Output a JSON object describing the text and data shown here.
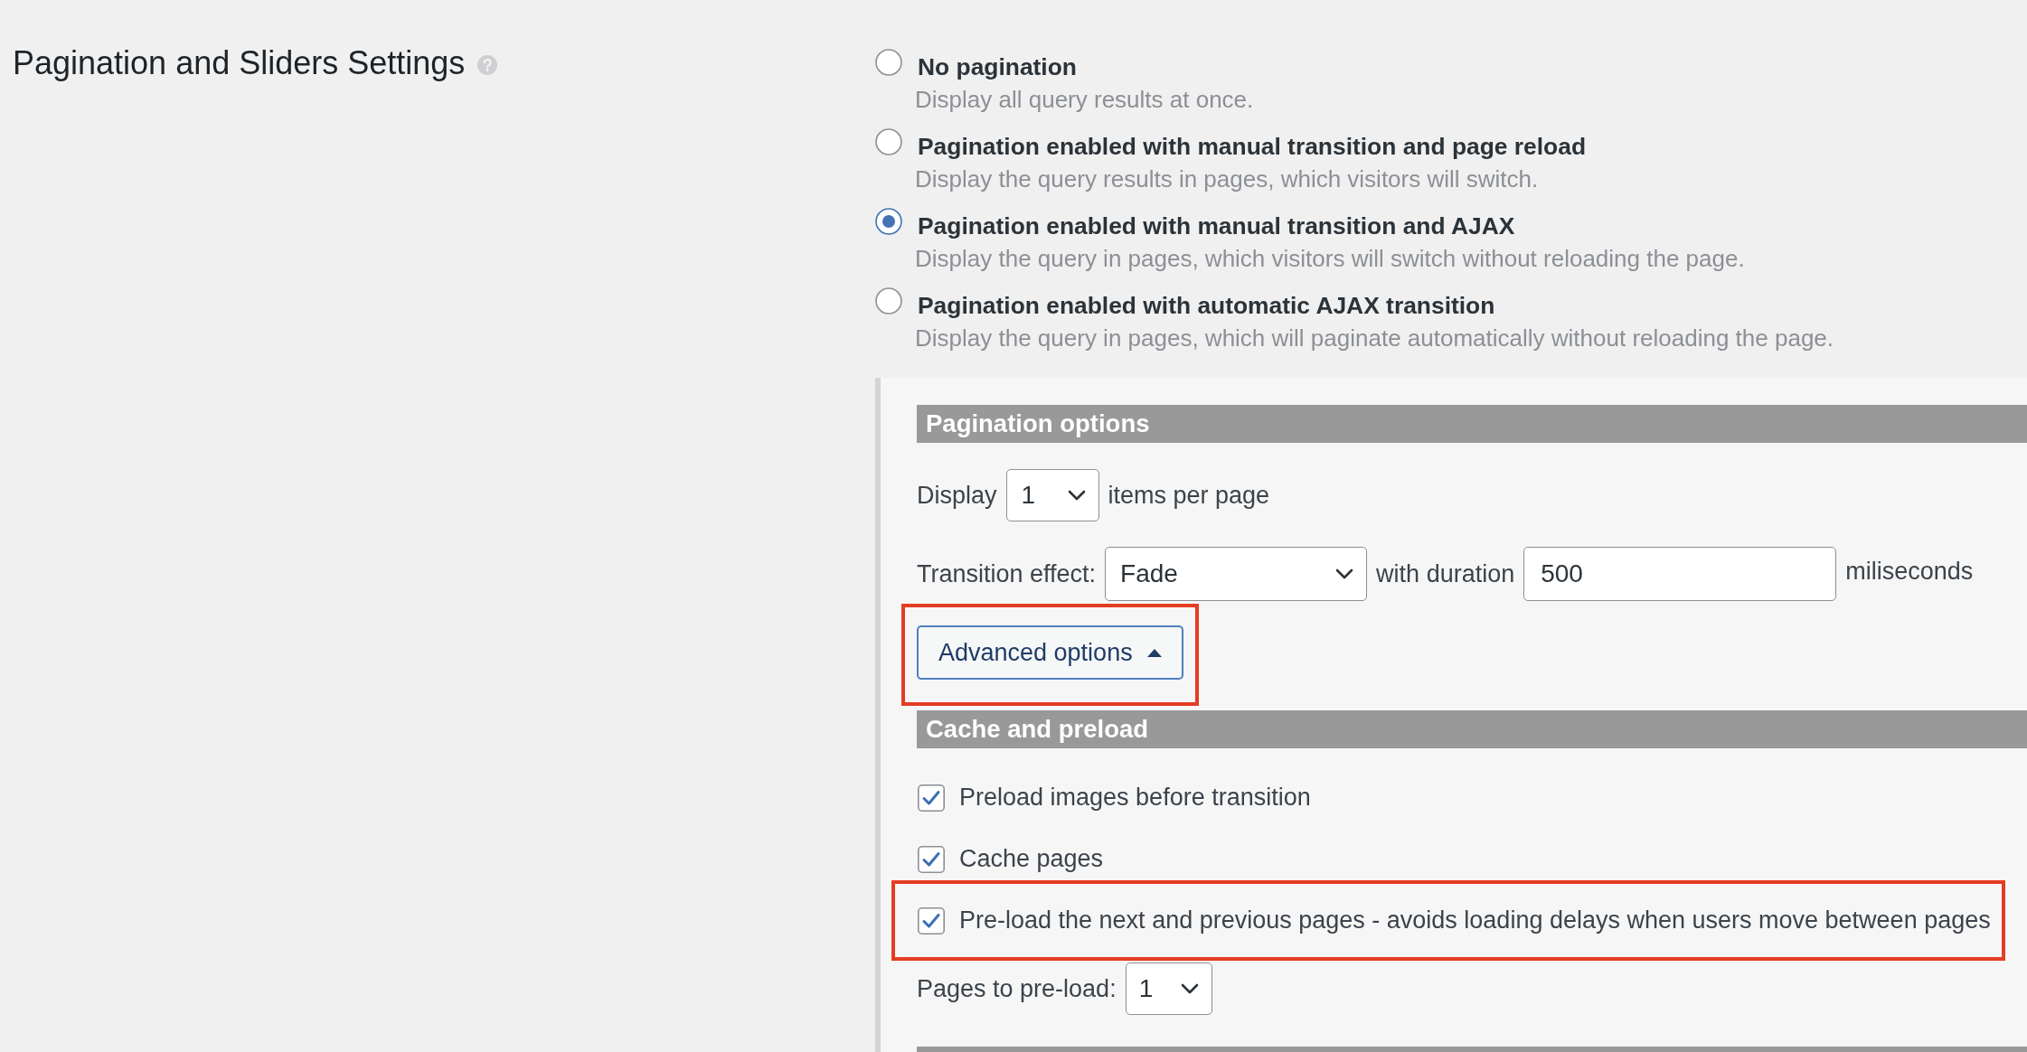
{
  "settings_title": "Pagination and Sliders Settings",
  "pagination_modes": [
    {
      "label": "No pagination",
      "description": "Display all query results at once.",
      "selected": false
    },
    {
      "label": "Pagination enabled with manual transition and page reload",
      "description": "Display the query results in pages, which visitors will switch.",
      "selected": false
    },
    {
      "label": "Pagination enabled with manual transition and AJAX",
      "description": "Display the query in pages, which visitors will switch without reloading the page.",
      "selected": true
    },
    {
      "label": "Pagination enabled with automatic AJAX transition",
      "description": "Display the query in pages, which will paginate automatically without reloading the page.",
      "selected": false
    }
  ],
  "pagination_options": {
    "heading": "Pagination options",
    "items_per_page": {
      "label_before": "Display",
      "value": "1",
      "label_after": "items per page"
    },
    "transition": {
      "label": "Transition effect:",
      "effect": "Fade",
      "duration_label": "with duration",
      "duration": "500",
      "unit": "miliseconds"
    },
    "advanced_button": {
      "label": "Advanced options",
      "expanded": true,
      "highlighted": true
    }
  },
  "cache_and_preload": {
    "heading": "Cache and preload",
    "checkboxes": [
      {
        "label": "Preload images before transition",
        "checked": true,
        "highlighted": false
      },
      {
        "label": "Cache pages",
        "checked": true,
        "highlighted": false
      },
      {
        "label": "Pre-load the next and previous pages - avoids loading delays when users move between pages",
        "checked": true,
        "highlighted": true
      }
    ],
    "pages_to_preload": {
      "label": "Pages to pre-load:",
      "value": "1"
    }
  }
}
